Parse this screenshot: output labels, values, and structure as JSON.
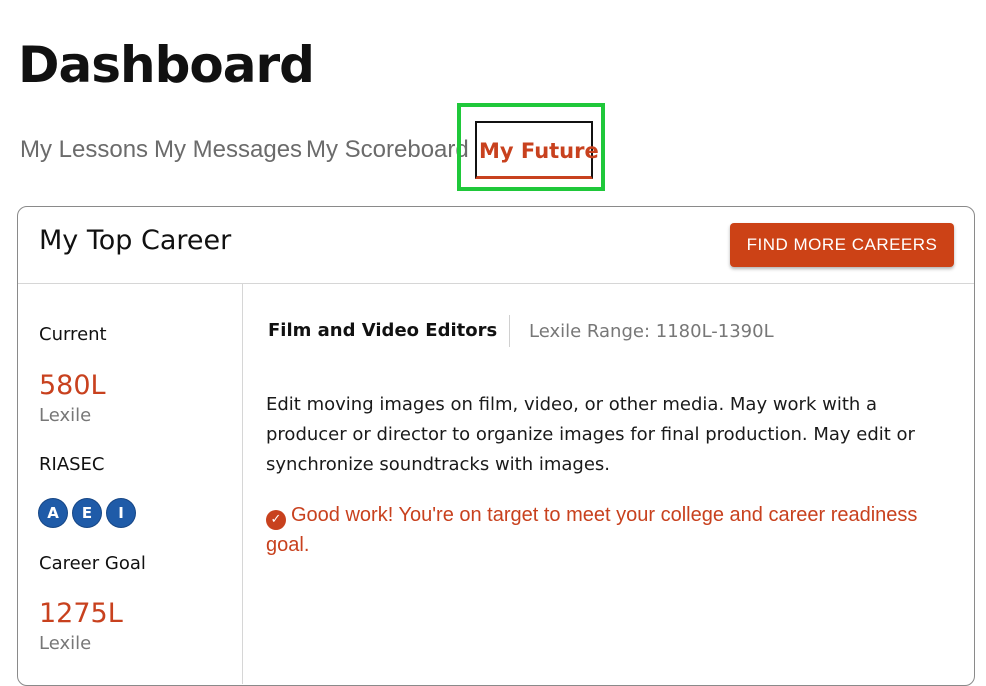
{
  "page": {
    "title": "Dashboard"
  },
  "tabs": [
    {
      "label": "My Lessons",
      "active": false
    },
    {
      "label": "My Messages",
      "active": false
    },
    {
      "label": "My Scoreboard",
      "active": false
    },
    {
      "label": "My Future",
      "active": true
    }
  ],
  "card": {
    "title": "My Top Career",
    "find_button": "FIND MORE CAREERS"
  },
  "sidebar": {
    "current_label": "Current",
    "current_value": "580L",
    "current_unit": "Lexile",
    "riasec_label": "RIASEC",
    "riasec_codes": [
      "A",
      "E",
      "I"
    ],
    "goal_label": "Career Goal",
    "goal_value": "1275L",
    "goal_unit": "Lexile"
  },
  "career": {
    "name": "Film and Video Editors",
    "lexile_range": "Lexile Range: 1180L-1390L",
    "description": "Edit moving images on film, video, or other media. May work with a producer or director to organize images for final production. May edit or synchronize soundtracks with images.",
    "readiness_message": "Good work! You're on target to meet your college and career readiness goal."
  },
  "colors": {
    "accent": "#c8411e",
    "button": "#cc4216",
    "badge": "#1f5ba8",
    "highlight": "#1fc83a"
  }
}
